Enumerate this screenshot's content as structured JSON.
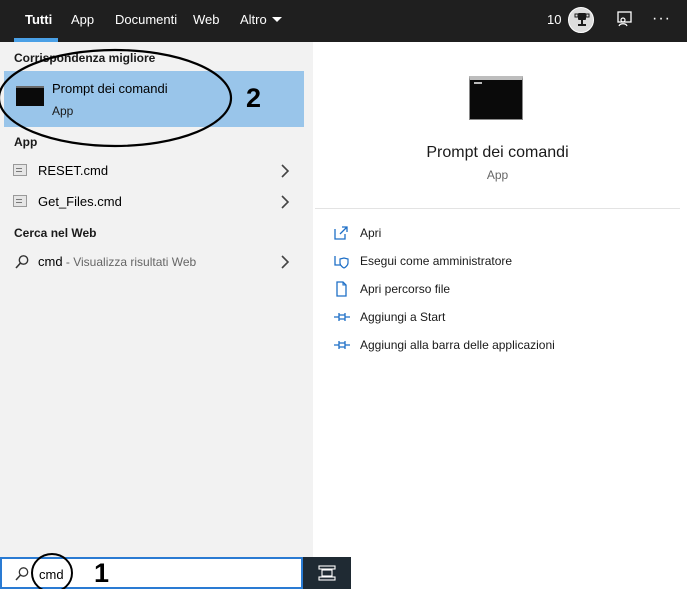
{
  "topbar": {
    "tabs": [
      {
        "label": "Tutti",
        "active": true
      },
      {
        "label": "App"
      },
      {
        "label": "Documenti"
      },
      {
        "label": "Web"
      },
      {
        "label": "Altro"
      }
    ],
    "points": "10",
    "accent_color": "#4aa0e6"
  },
  "left": {
    "best_match_header": "Corrispondenza migliore",
    "best_match": {
      "title": "Prompt dei comandi",
      "subtitle": "App"
    },
    "apps_header": "App",
    "apps": [
      {
        "label": "RESET.cmd"
      },
      {
        "label": "Get_Files.cmd"
      }
    ],
    "web_header": "Cerca nel Web",
    "web_result": {
      "query": "cmd",
      "suffix": " - Visualizza risultati Web"
    },
    "highlight_color": "#99c5ea"
  },
  "right": {
    "title": "Prompt dei comandi",
    "subtitle": "App",
    "actions": [
      {
        "label": "Apri",
        "icon": "open-icon"
      },
      {
        "label": "Esegui come amministratore",
        "icon": "shield-icon"
      },
      {
        "label": "Apri percorso file",
        "icon": "file-location-icon"
      },
      {
        "label": "Aggiungi a Start",
        "icon": "pin-icon"
      },
      {
        "label": "Aggiungi alla barra delle applicazioni",
        "icon": "pin-taskbar-icon"
      }
    ]
  },
  "search": {
    "value": "cmd"
  },
  "annotations": {
    "step1": "1",
    "step2": "2"
  }
}
